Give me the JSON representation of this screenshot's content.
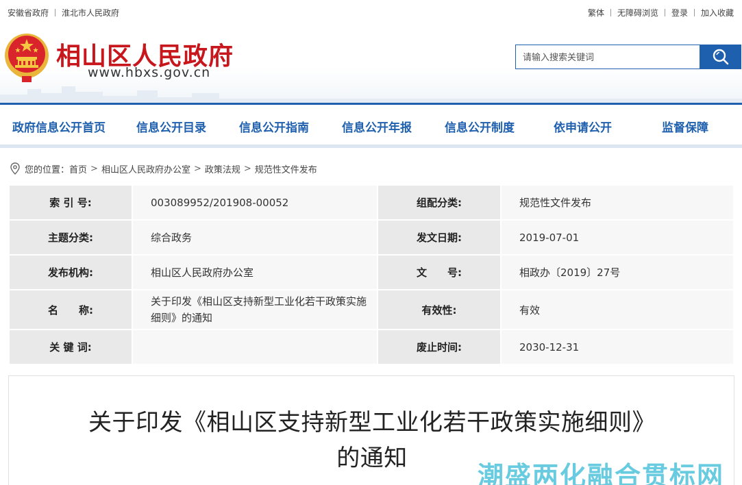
{
  "topbar": {
    "left_links": [
      "安徽省政府",
      "淮北市人民政府"
    ],
    "right_links": [
      "繁体",
      "无障碍浏览",
      "登录",
      "加入收藏"
    ]
  },
  "header": {
    "site_title": "相山区人民政府",
    "site_url": "www.hbxs.gov.cn",
    "search_placeholder": "请输入搜索关键词",
    "search_icon": "search-icon"
  },
  "nav": {
    "items": [
      "政府信息公开首页",
      "信息公开目录",
      "信息公开指南",
      "信息公开年报",
      "信息公开制度",
      "依申请公开",
      "监督保障"
    ]
  },
  "breadcrumb": {
    "prefix": "您的位置：",
    "items": [
      "首页",
      "相山区人民政府办公室",
      "政策法规",
      "规范性文件发布"
    ],
    "separator": ">"
  },
  "info": {
    "index_label": "索 引 号:",
    "index_value": "003089952/201908-00052",
    "group_label": "组配分类:",
    "group_value": "规范性文件发布",
    "topic_label": "主题分类:",
    "topic_value": "综合政务",
    "date_label": "发文日期:",
    "date_value": "2019-07-01",
    "org_label": "发布机构:",
    "org_value": "相山区人民政府办公室",
    "docno_label": "文　　号:",
    "docno_value": "相政办〔2019〕27号",
    "name_label": "名　　称:",
    "name_value": "关于印发《相山区支持新型工业化若干政策实施细则》的通知",
    "validity_label": "有效性:",
    "validity_value": "有效",
    "keywords_label": "关 键 词:",
    "keywords_value": "",
    "expire_label": "废止时间:",
    "expire_value": "2030-12-31"
  },
  "article": {
    "title_line1": "关于印发《相山区支持新型工业化若干政策实施细则》",
    "title_line2": "的通知"
  },
  "watermark": "潮盛两化融合贯标网",
  "colors": {
    "brand_blue": "#1f60ae",
    "title_red": "#c8161d",
    "watermark": "#4fc3da"
  }
}
